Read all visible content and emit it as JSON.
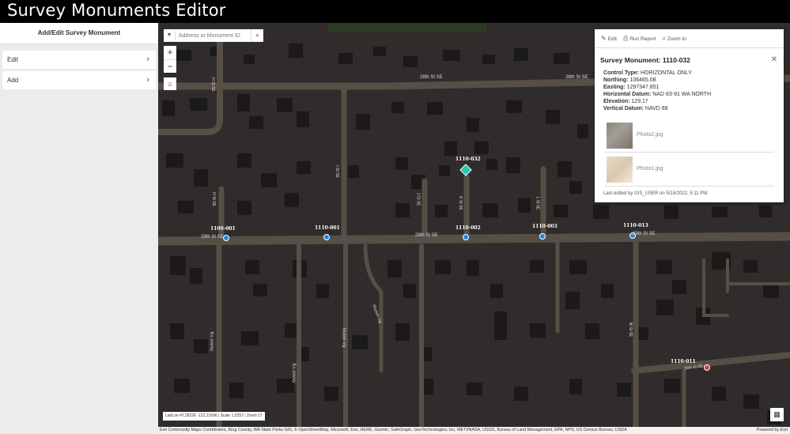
{
  "app": {
    "title": "Survey Monuments Editor"
  },
  "sidebar": {
    "header": "Add/Edit Survey Monument",
    "items": [
      {
        "label": "Edit"
      },
      {
        "label": "Add"
      }
    ]
  },
  "search": {
    "placeholder": "Address or Monument ID"
  },
  "popup": {
    "toolbar": {
      "edit": "Edit",
      "run_report": "Run Report",
      "zoom_to": "Zoom to"
    },
    "title": "Survey Monument: 1110-032",
    "fields": [
      {
        "label": "Control Type:",
        "value": "HORIZONTAL ONLY"
      },
      {
        "label": "Northing:",
        "value": "106465.08"
      },
      {
        "label": "Easting:",
        "value": "1297347.851"
      },
      {
        "label": "Horizontal Datum:",
        "value": "NAD 83-91 WA NORTH"
      },
      {
        "label": "Elevation:",
        "value": "129.17"
      },
      {
        "label": "Vertical Datum:",
        "value": "NAVD 88"
      }
    ],
    "attachments": [
      {
        "name": "Photo2.jpg"
      },
      {
        "name": "Photo1.jpg"
      }
    ],
    "edited": "Last edited by GIS_USER on 5/15/2022, 5:11 PM."
  },
  "map": {
    "streets": {
      "s28_left": "28th St SE",
      "s28_right": "28th St SE",
      "s29_left": "29th St SE",
      "s29_mid": "29th St SE",
      "s29_right": "29th St SE",
      "h_top": "H St SE",
      "h_mid": "H St SE",
      "i": "I St SE",
      "j": "J Ct SE",
      "k": "K St SE",
      "l": "L St SE",
      "m": "M St SE",
      "sky1": "Skylark Vig",
      "sky2": "Skylark Vig",
      "sky3": "Skylark Vig",
      "sky4": "Skylark Vig",
      "s30": "30th St SE"
    },
    "monuments": [
      "1109-001",
      "1110-001",
      "1110-002",
      "1110-003",
      "1110-013",
      "1110-032",
      "1110-011"
    ],
    "coords": "Lat/Lon 47.28226 -122.21696 | Scale 1:2257 | Zoom 17",
    "attribution": "Esri Community Maps Contributors, King County, WA State Parks GIS, © OpenStreetMap, Microsoft, Esri, HERE, Garmin, SafeGraph, GeoTechnologies, Inc, METI/NASA, USGS, Bureau of Land Management, EPA, NPS, US Census Bureau, USDA",
    "powered_by": "Powered by Esri"
  },
  "colors": {
    "road": "#5a5149",
    "road_edge": "#6e655c",
    "building": "#1a1a1a",
    "marker": "#1e88e5",
    "selected": "#27c7b0",
    "alert": "#e53935"
  }
}
